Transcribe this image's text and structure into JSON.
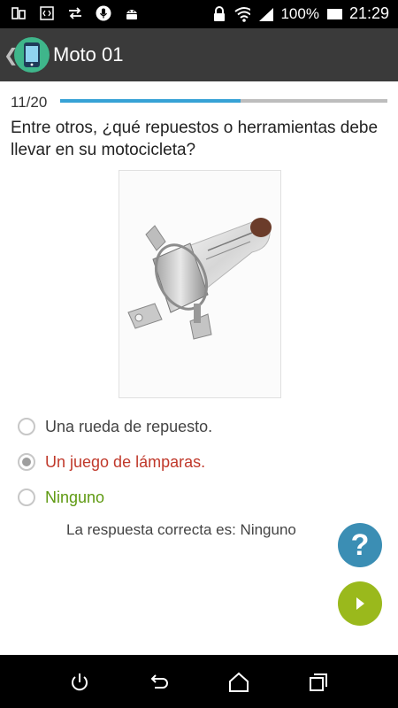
{
  "status_bar": {
    "battery": "100%",
    "time": "21:29",
    "icons": [
      "screen-mirror-icon",
      "code-icon",
      "sync-arrows-icon",
      "microphone-icon",
      "android-icon",
      "lock-icon",
      "wifi-icon",
      "signal-icon",
      "battery-icon"
    ]
  },
  "app_bar": {
    "title": "Moto 01",
    "back_icon": "chevron-left-icon",
    "app_icon": "phone-app-icon"
  },
  "quiz": {
    "progress_label": "11/20",
    "progress_fraction": 0.55,
    "question": "Entre otros, ¿qué repuestos o herramientas debe llevar en su motocicleta?",
    "image_subject": "halogen headlight bulb",
    "options": [
      {
        "label": "Una rueda de repuesto.",
        "state": "default"
      },
      {
        "label": "Un juego de lámparas.",
        "state": "selected-wrong"
      },
      {
        "label": "Ninguno",
        "state": "correct"
      }
    ],
    "answer_text": "La respuesta correcta es: Ninguno",
    "help_icon": "question-mark-icon",
    "next_icon": "play-next-icon"
  },
  "nav_bar": {
    "icons": [
      "power-icon",
      "back-icon",
      "home-icon",
      "recents-icon"
    ]
  },
  "colors": {
    "progress_fill": "#37a2d6",
    "wrong": "#c0392b",
    "correct": "#5f9a12",
    "help_button": "#3b8eb4",
    "next_button": "#9ab91c"
  }
}
